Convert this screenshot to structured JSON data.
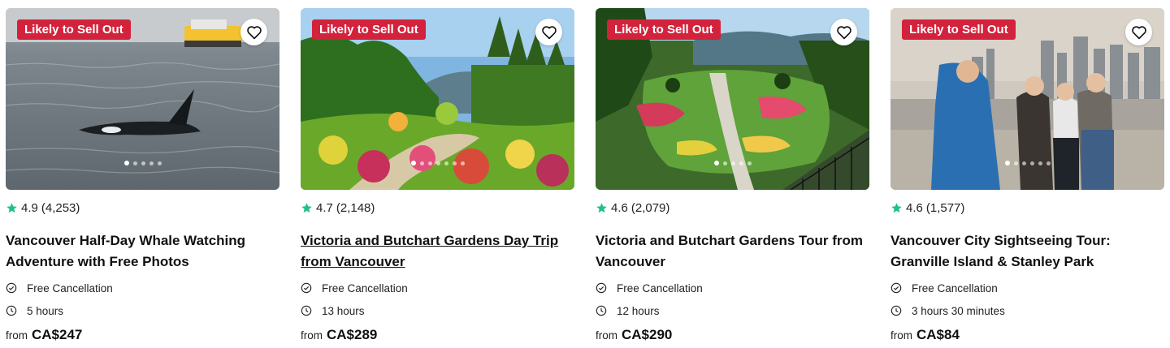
{
  "accent_color": "#d3223c",
  "star_color": "#1ec18d",
  "cards": [
    {
      "badge": "Likely to Sell Out",
      "rating": "4.9",
      "reviews": "(4,253)",
      "title": "Vancouver Half-Day Whale Watching Adventure with Free Photos",
      "cancellation": "Free Cancellation",
      "duration": "5 hours",
      "price_prefix": "from",
      "price": "CA$247"
    },
    {
      "badge": "Likely to Sell Out",
      "rating": "4.7",
      "reviews": "(2,148)",
      "title": "Victoria and Butchart Gardens Day Trip from Vancouver",
      "cancellation": "Free Cancellation",
      "duration": "13 hours",
      "price_prefix": "from",
      "price": "CA$289"
    },
    {
      "badge": "Likely to Sell Out",
      "rating": "4.6",
      "reviews": "(2,079)",
      "title": "Victoria and Butchart Gardens Tour from Vancouver",
      "cancellation": "Free Cancellation",
      "duration": "12 hours",
      "price_prefix": "from",
      "price": "CA$290"
    },
    {
      "badge": "Likely to Sell Out",
      "rating": "4.6",
      "reviews": "(1,577)",
      "title": "Vancouver City Sightseeing Tour: Granville Island & Stanley Park",
      "cancellation": "Free Cancellation",
      "duration": "3 hours 30 minutes",
      "price_prefix": "from",
      "price": "CA$84"
    }
  ]
}
